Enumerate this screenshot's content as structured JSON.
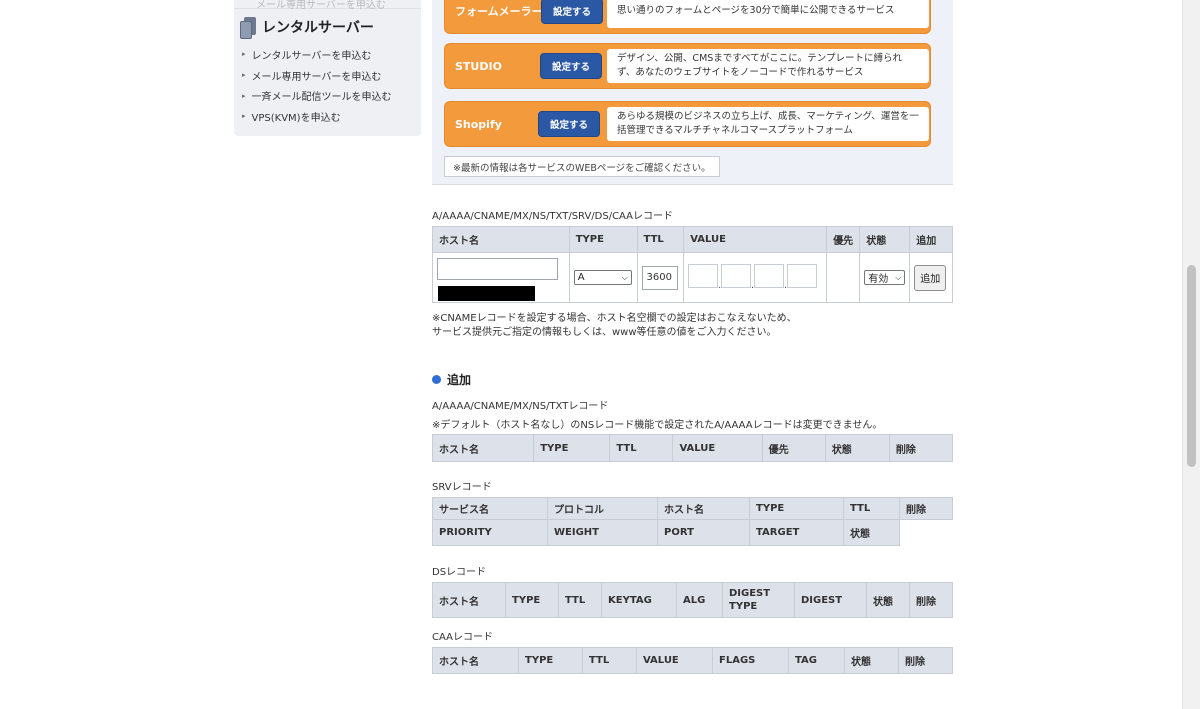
{
  "sidebar": {
    "top_cut_text": "メール専用サーバーを申込む",
    "section_title": "レンタルサーバー",
    "items": [
      "レンタルサーバーを申込む",
      "メール専用サーバーを申込む",
      "一斉メール配信ツールを申込む",
      "VPS(KVM)を申込む"
    ]
  },
  "services": [
    {
      "name": "フォームメーラー",
      "button": "設定する",
      "desc": "思い通りのフォームとページを30分で簡単に公開できるサービス"
    },
    {
      "name": "STUDIO",
      "button": "設定する",
      "desc": "デザイン、公開、CMSまですべてがここに。テンプレートに縛られず、あなたのウェブサイトをノーコードで作れるサービス"
    },
    {
      "name": "Shopify",
      "button": "設定する",
      "desc": "あらゆる規模のビジネスの立ち上げ、成長、マーケティング、運営を一括管理できるマルチチャネルコマースプラットフォーム"
    }
  ],
  "services_note": "※最新の情報は各サービスのWEBページをご確認ください。",
  "entry": {
    "label": "A/AAAA/CNAME/MX/NS/TXT/SRV/DS/CAAレコード",
    "headers": [
      "ホスト名",
      "TYPE",
      "TTL",
      "VALUE",
      "優先",
      "状態",
      "追加"
    ],
    "type_value": "A",
    "ttl_value": "3600",
    "status_value": "有効",
    "add_button": "追加",
    "note_line1": "※CNAMEレコードを設定する場合、ホスト名空欄での設定はおこなえないため、",
    "note_line2": "サービス提供元ご指定の情報もしくは、www等任意の値をご入力ください。"
  },
  "add_section": {
    "title": "追加",
    "label": "A/AAAA/CNAME/MX/NS/TXTレコード",
    "note": "※デフォルト（ホスト名なし）のNSレコード機能で設定されたA/AAAAレコードは変更できません。",
    "headers": [
      "ホスト名",
      "TYPE",
      "TTL",
      "VALUE",
      "優先",
      "状態",
      "削除"
    ]
  },
  "srv": {
    "label": "SRVレコード",
    "headers_row1": [
      "サービス名",
      "プロトコル",
      "ホスト名",
      "TYPE",
      "TTL",
      "削除"
    ],
    "headers_row2": [
      "PRIORITY",
      "WEIGHT",
      "PORT",
      "TARGET",
      "状態"
    ]
  },
  "ds": {
    "label": "DSレコード",
    "headers": [
      "ホスト名",
      "TYPE",
      "TTL",
      "KEYTAG",
      "ALG",
      "DIGEST TYPE",
      "DIGEST",
      "状態",
      "削除"
    ]
  },
  "caa": {
    "label": "CAAレコード",
    "headers": [
      "ホスト名",
      "TYPE",
      "TTL",
      "VALUE",
      "FLAGS",
      "TAG",
      "状態",
      "削除"
    ]
  }
}
